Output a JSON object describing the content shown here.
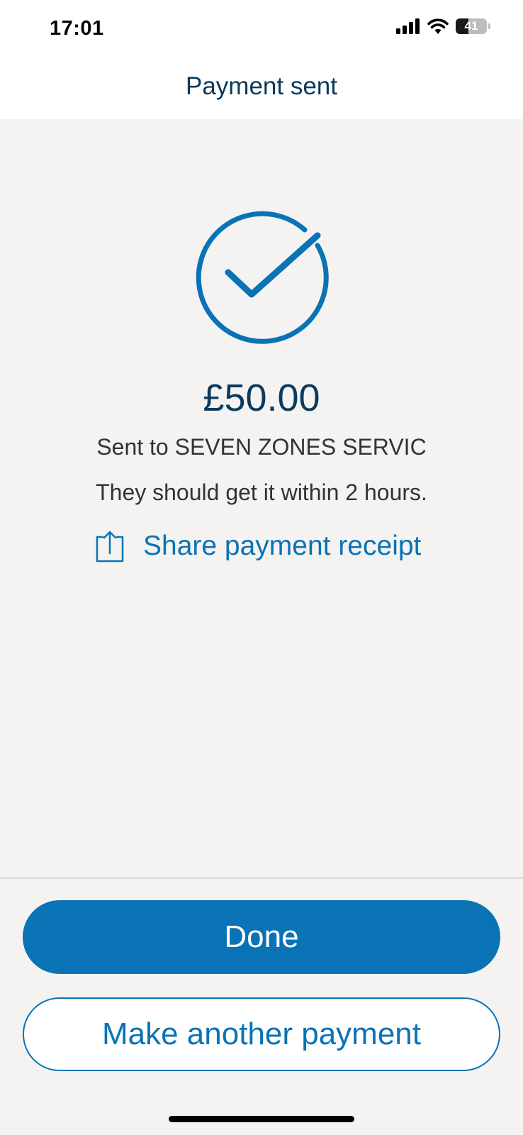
{
  "status_bar": {
    "time": "17:01",
    "battery_level": "41",
    "battery_fraction": 0.41,
    "icons": [
      "signal-icon",
      "wifi-icon",
      "battery-icon"
    ]
  },
  "header": {
    "title": "Payment sent"
  },
  "confirmation": {
    "icon": "checkmark-circle-icon",
    "amount": "£50.00",
    "recipient_line": "Sent to SEVEN ZONES SERVIC",
    "timing_line": "They should get it within 2 hours.",
    "share_icon": "share-icon",
    "share_label": "Share payment receipt"
  },
  "actions": {
    "done_label": "Done",
    "another_label": "Make another payment"
  },
  "colors": {
    "accent": "#0a73b5",
    "title": "#0b3a5c",
    "background": "#f4f3f2",
    "text": "#333333"
  }
}
